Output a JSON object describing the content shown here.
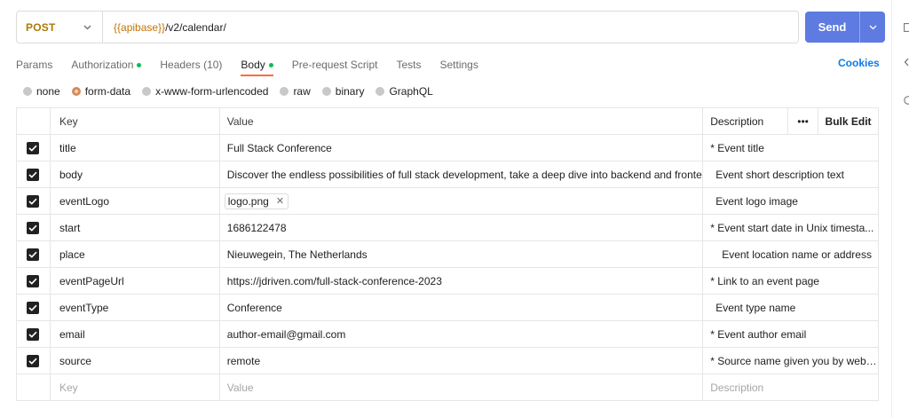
{
  "request": {
    "method": "POST",
    "url_var": "{{apibase}}",
    "url_path": "/v2/calendar/",
    "send_label": "Send"
  },
  "tabs": [
    {
      "label": "Params"
    },
    {
      "label": "Authorization"
    },
    {
      "label": "Headers (10)"
    },
    {
      "label": "Body"
    },
    {
      "label": "Pre-request Script"
    },
    {
      "label": "Tests"
    },
    {
      "label": "Settings"
    }
  ],
  "cookies_label": "Cookies",
  "body_types": [
    {
      "label": "none"
    },
    {
      "label": "form-data"
    },
    {
      "label": "x-www-form-urlencoded"
    },
    {
      "label": "raw"
    },
    {
      "label": "binary"
    },
    {
      "label": "GraphQL"
    }
  ],
  "table": {
    "headers": {
      "key": "Key",
      "value": "Value",
      "description": "Description",
      "more": "•••",
      "bulk_edit": "Bulk Edit"
    },
    "rows": [
      {
        "key": "title",
        "value": "Full Stack Conference",
        "description": "* Event title"
      },
      {
        "key": "body",
        "value": "Discover the endless possibilities of full stack development, take a deep dive into backend and fronten...",
        "description": "Event short description text"
      },
      {
        "key": "eventLogo",
        "value": "logo.png",
        "description": "Event logo image"
      },
      {
        "key": "start",
        "value": "1686122478",
        "description": "* Event start date in Unix timesta..."
      },
      {
        "key": "place",
        "value": "Nieuwegein, The Netherlands",
        "description": "Event location name or address"
      },
      {
        "key": "eventPageUrl",
        "value": "https://jdriven.com/full-stack-conference-2023",
        "description": "* Link to an event page"
      },
      {
        "key": "eventType",
        "value": "Conference",
        "description": "Event type name"
      },
      {
        "key": "email",
        "value": "author-email@gmail.com",
        "description": "* Event author email"
      },
      {
        "key": "source",
        "value": "remote",
        "description": "* Source name given you by webs..."
      }
    ],
    "placeholders": {
      "key": "Key",
      "value": "Value",
      "description": "Description"
    }
  },
  "colors": {
    "method": "#ad7a03",
    "send": "#5d7be0",
    "active_tab_underline": "#ff6c37",
    "status_dot": "#0cbb52",
    "link": "#097bed"
  }
}
